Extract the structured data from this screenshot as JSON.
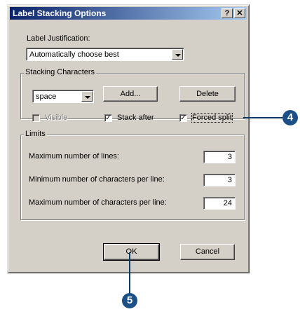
{
  "window": {
    "title": "Label Stacking Options",
    "help_button": "?",
    "close_button": "✕"
  },
  "justification": {
    "label": "Label Justification:",
    "selected": "Automatically choose best"
  },
  "stacking": {
    "group_title": "Stacking Characters",
    "selected_char": "space",
    "add_button": "Add...",
    "delete_button": "Delete",
    "visible_label": "Visible",
    "visible_checked": false,
    "stack_after_label": "Stack after",
    "stack_after_checked": true,
    "forced_split_label": "Forced split",
    "forced_split_checked": true,
    "check_mark": "✓"
  },
  "limits": {
    "group_title": "Limits",
    "max_lines_label": "Maximum number of lines:",
    "max_lines_value": "3",
    "min_chars_label": "Minimum number of characters per line:",
    "min_chars_value": "3",
    "max_chars_label": "Maximum number of characters per line:",
    "max_chars_value": "24"
  },
  "footer": {
    "ok_button": "OK",
    "cancel_button": "Cancel"
  },
  "callouts": {
    "forced_split_step": "4",
    "ok_step": "5"
  }
}
